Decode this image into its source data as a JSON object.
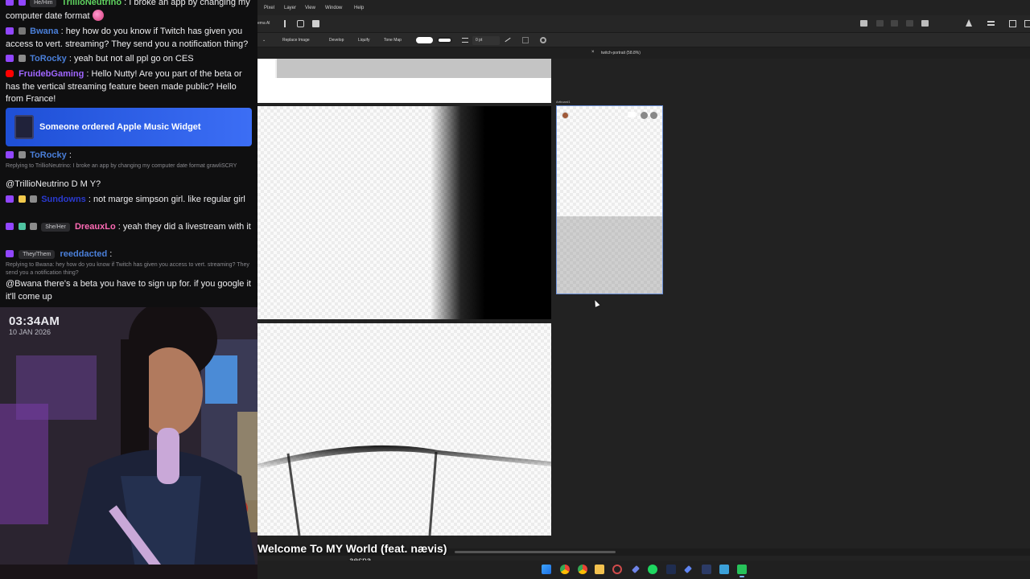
{
  "chat": {
    "top_line": {
      "chip": "He/Him",
      "user": "TrillioNeutrino",
      "text": ": I broke an app by changing my computer date format"
    },
    "m1": {
      "user": "Bwana",
      "text": ": hey how do you know if Twitch has given you access to vert. streaming? They send you a notification thing?"
    },
    "m2": {
      "user": "ToRocky",
      "text": ": yeah but not all ppl go on CES"
    },
    "m3": {
      "user": "FruidebGaming",
      "text": ": Hello Nutty! Are you part of the beta or has the vertical streaming feature been made public? Hello from France!"
    },
    "alert": "Someone ordered Apple Music Widget",
    "m4": {
      "user": "ToRocky",
      "text": ":",
      "reply": "Replying to TrillioNeutrino: I broke an app by changing my computer date format grawliSCRY",
      "body": "@TrillioNeutrino D M Y?"
    },
    "m5": {
      "user": "Sundowns",
      "text": ": not marge simpson girl. like regular girl"
    },
    "m6": {
      "chip": "She/Her",
      "user": "DreauxLo",
      "text": ": yeah they did a livestream with it"
    },
    "m7": {
      "chip": "They/Them",
      "user": "reeddacted",
      "text": ":",
      "reply": "Replying to Bwana: hey how do you know if Twitch has given you access to vert. streaming? They send you a notification thing?",
      "body": "@Bwana there's a beta you have to sign up for. if you google it it'll come up"
    }
  },
  "cam": {
    "time": "03:34AM",
    "date": "10 JAN 2026"
  },
  "app": {
    "menu": [
      "Pixel",
      "Layer",
      "View",
      "Window",
      "Help"
    ],
    "partial_label": "ema AI",
    "toolbar2": {
      "replace": "Replace Image",
      "develop": "Develop",
      "liquify": "Liquify",
      "tonemap": "Tone Map",
      "stroke": "0 pt"
    },
    "tab": {
      "close": "×",
      "name": "twitch-portrait (58.8%)"
    },
    "artboard_label": "Artboard1"
  },
  "song": {
    "title": "Welcome To MY World (feat. nævis)",
    "artist": "aespa"
  },
  "colors": {
    "twitch": "#9146ff",
    "youtube": "#ff0000",
    "alert": "#2a5fe8",
    "user_blue": "#4a7fd9",
    "user_green": "#5fd35f",
    "user_purple": "#a066ff",
    "user_pink": "#ff6ab5"
  }
}
